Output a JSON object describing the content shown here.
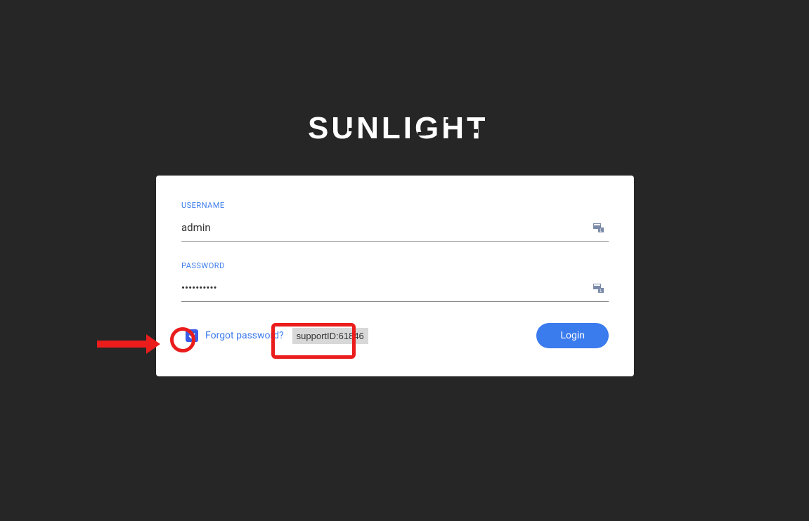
{
  "brand": {
    "name": "SUNLIGHT"
  },
  "form": {
    "username_label": "USERNAME",
    "username_value": "admin",
    "password_label": "PASSWORD",
    "password_value": "••••••••••",
    "forgot_link": "Forgot password?",
    "support_id": "supportID:61846",
    "login_button": "Login"
  },
  "colors": {
    "background": "#262626",
    "card": "#ffffff",
    "accent": "#3a7bed",
    "annotation": "#ea1c1c"
  }
}
